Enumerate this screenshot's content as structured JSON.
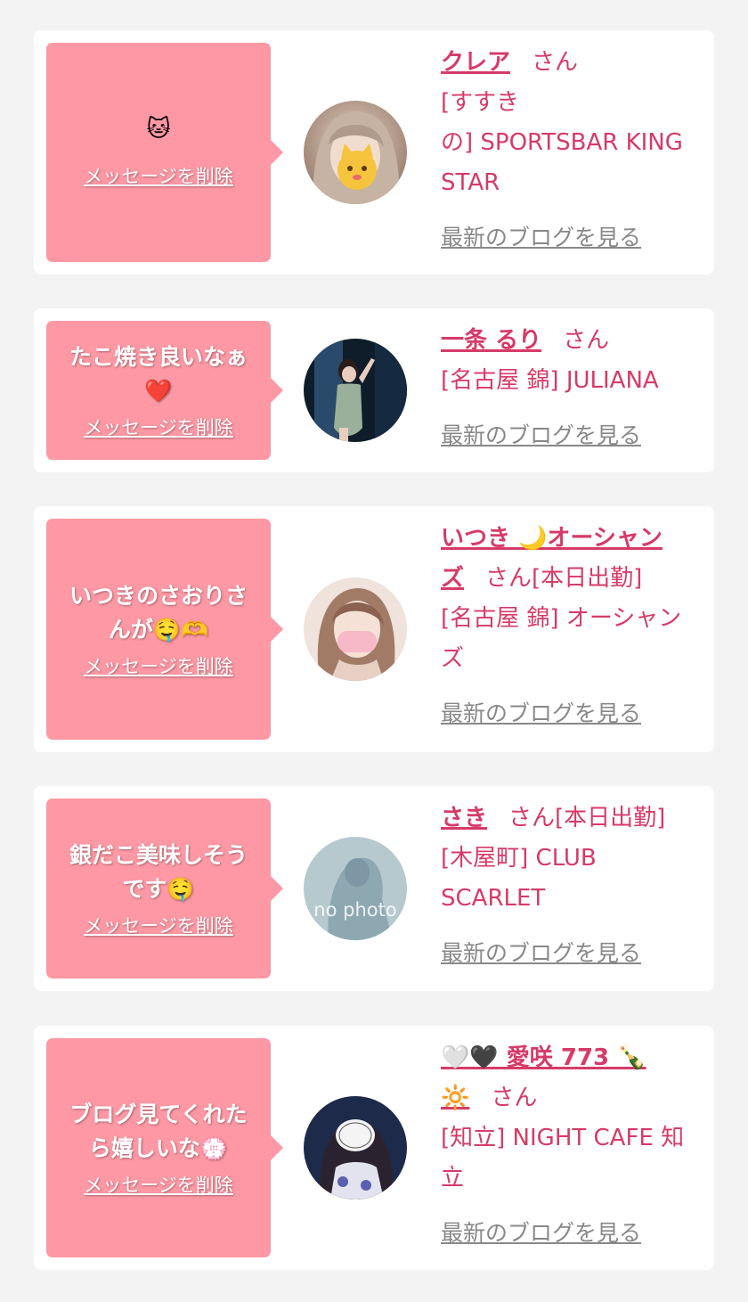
{
  "cards": [
    {
      "message": "",
      "message_icon": "🐱",
      "delete_label": "メッセージを削除",
      "name": "クレア",
      "san": "さん",
      "status": "",
      "shop_lines": [
        "[すすき",
        "の] SPORTSBAR KING",
        "STAR"
      ],
      "blog_label": "最新のブログを見る"
    },
    {
      "message": "たこ焼き良いなぁ",
      "message_icon": "❤️",
      "delete_label": "メッセージを削除",
      "name": "一条 るり",
      "san": "さん",
      "status": "",
      "shop_lines": [
        "[名古屋 錦] JULIANA"
      ],
      "blog_label": "最新のブログを見る"
    },
    {
      "message_lines": [
        "いつきのさおりさ",
        "んが🤤🫶"
      ],
      "delete_label": "メッセージを削除",
      "name_line1": "いつき 🌙オーシャン",
      "name_line2": "ズ",
      "san": "さん",
      "status": "[本日出勤]",
      "shop_lines": [
        "[名古屋 錦] オーシャン",
        "ズ"
      ],
      "blog_label": "最新のブログを見る"
    },
    {
      "message_lines": [
        "銀だこ美味しそう",
        "です🤤"
      ],
      "delete_label": "メッセージを削除",
      "name": "さき",
      "san": "さん",
      "status": "[本日出勤]",
      "shop_lines": [
        "[木屋町] CLUB",
        "SCARLET"
      ],
      "blog_label": "最新のブログを見る",
      "avatar_text": "no photo"
    },
    {
      "message_lines": [
        "ブログ見てくれた",
        "ら嬉しいな💮"
      ],
      "delete_label": "メッセージを削除",
      "name_line1": "🤍🖤 愛咲 773 🍾",
      "name_line2": "🔆",
      "san": "さん",
      "status": "",
      "shop_lines": [
        "[知立] NIGHT CAFE 知",
        "立"
      ],
      "blog_label": "最新のブログを見る"
    }
  ],
  "colors": {
    "background": "#f3f3f3",
    "bubble": "#fd98a4",
    "name": "#d63b68",
    "blog_link": "#888888"
  },
  "icons": {
    "avatar_0": "portrait-photo-cat-sticker-icon",
    "avatar_1": "portrait-photo-icon",
    "avatar_2": "portrait-photo-mask-icon",
    "avatar_3": "no-photo-placeholder-icon",
    "avatar_4": "portrait-photo-sticker-icon"
  }
}
